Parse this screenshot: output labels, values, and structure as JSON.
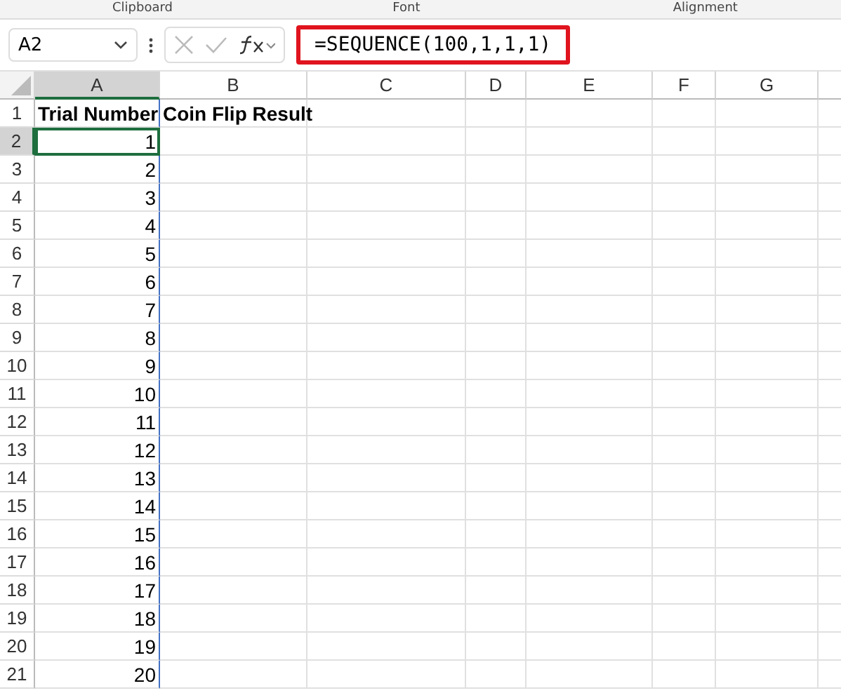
{
  "ribbon_groups": [
    "Clipboard",
    "Font",
    "Alignment"
  ],
  "formula_bar": {
    "name_box": "A2",
    "formula": "=SEQUENCE(100,1,1,1)",
    "highlighted": true
  },
  "columns": [
    {
      "label": "A",
      "selected": true
    },
    {
      "label": "B",
      "selected": false
    },
    {
      "label": "C",
      "selected": false
    },
    {
      "label": "D",
      "selected": false
    },
    {
      "label": "E",
      "selected": false
    },
    {
      "label": "F",
      "selected": false
    },
    {
      "label": "G",
      "selected": false
    }
  ],
  "rows": [
    {
      "label": "1",
      "selected": false,
      "cells": [
        "Trial Number",
        "Coin Flip Result"
      ],
      "kind": "header"
    },
    {
      "label": "2",
      "selected": true,
      "cells": [
        "1"
      ],
      "kind": "number"
    },
    {
      "label": "3",
      "selected": false,
      "cells": [
        "2"
      ],
      "kind": "number"
    },
    {
      "label": "4",
      "selected": false,
      "cells": [
        "3"
      ],
      "kind": "number"
    },
    {
      "label": "5",
      "selected": false,
      "cells": [
        "4"
      ],
      "kind": "number"
    },
    {
      "label": "6",
      "selected": false,
      "cells": [
        "5"
      ],
      "kind": "number"
    },
    {
      "label": "7",
      "selected": false,
      "cells": [
        "6"
      ],
      "kind": "number"
    },
    {
      "label": "8",
      "selected": false,
      "cells": [
        "7"
      ],
      "kind": "number"
    },
    {
      "label": "9",
      "selected": false,
      "cells": [
        "8"
      ],
      "kind": "number"
    },
    {
      "label": "10",
      "selected": false,
      "cells": [
        "9"
      ],
      "kind": "number"
    },
    {
      "label": "11",
      "selected": false,
      "cells": [
        "10"
      ],
      "kind": "number"
    },
    {
      "label": "12",
      "selected": false,
      "cells": [
        "11"
      ],
      "kind": "number"
    },
    {
      "label": "13",
      "selected": false,
      "cells": [
        "12"
      ],
      "kind": "number"
    },
    {
      "label": "14",
      "selected": false,
      "cells": [
        "13"
      ],
      "kind": "number"
    },
    {
      "label": "15",
      "selected": false,
      "cells": [
        "14"
      ],
      "kind": "number"
    },
    {
      "label": "16",
      "selected": false,
      "cells": [
        "15"
      ],
      "kind": "number"
    },
    {
      "label": "17",
      "selected": false,
      "cells": [
        "16"
      ],
      "kind": "number"
    },
    {
      "label": "18",
      "selected": false,
      "cells": [
        "17"
      ],
      "kind": "number"
    },
    {
      "label": "19",
      "selected": false,
      "cells": [
        "18"
      ],
      "kind": "number"
    },
    {
      "label": "20",
      "selected": false,
      "cells": [
        "19"
      ],
      "kind": "number"
    },
    {
      "label": "21",
      "selected": false,
      "cells": [
        "20"
      ],
      "kind": "number"
    }
  ]
}
